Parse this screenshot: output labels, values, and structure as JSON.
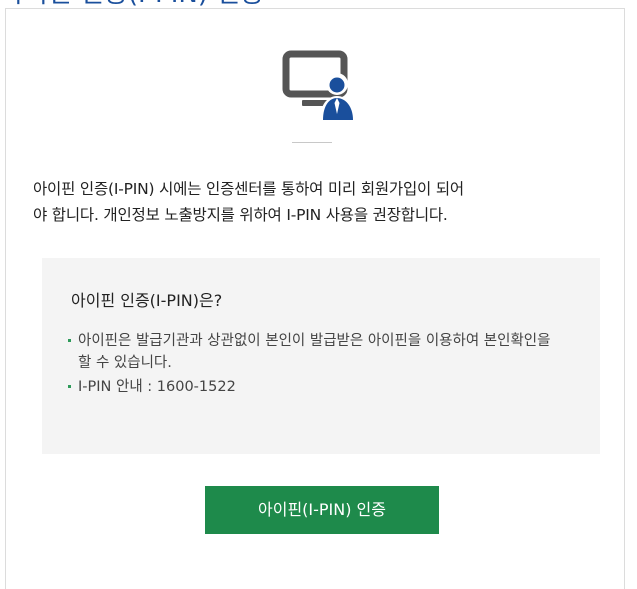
{
  "page": {
    "title_fragment": "아이핀 인증(I-PIN) 인증"
  },
  "icon": {
    "name": "monitor-user-icon",
    "colors": {
      "monitor": "#555555",
      "user": "#1a4f9c"
    }
  },
  "description": {
    "line1": "아이핀 인증(I-PIN) 시에는 인증센터를 통하여 미리 회원가입이 되어",
    "line2": "야 합니다. 개인정보 노출방지를 위하여 I-PIN 사용을 권장합니다."
  },
  "info": {
    "title": "아이핀 인증(I-PIN)은?",
    "items": [
      "아이핀은 발급기관과 상관없이 본인이 발급받은 아이핀을 이용하여 본인확인을 할 수 있습니다.",
      "I-PIN 안내 : 1600-1522"
    ]
  },
  "button": {
    "label": "아이핀(I-PIN) 인증",
    "color": "#1e8a4b"
  }
}
